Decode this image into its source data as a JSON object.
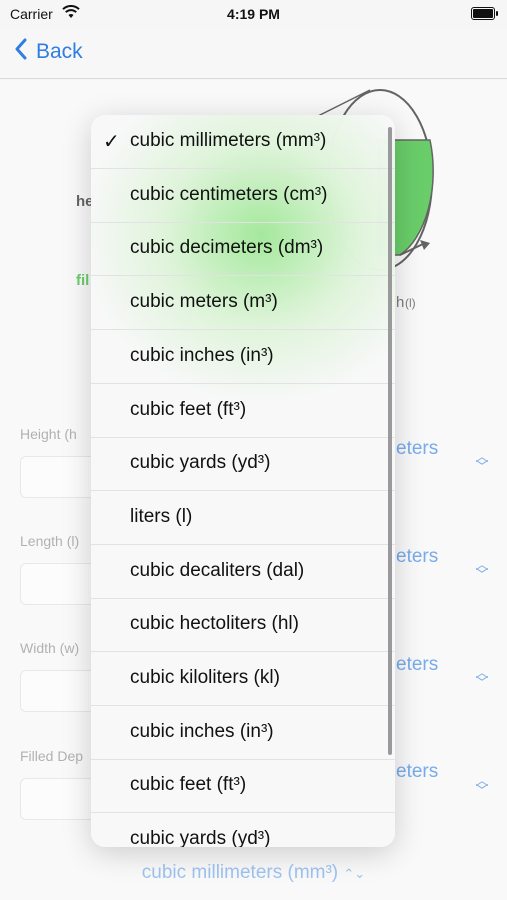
{
  "status": {
    "carrier": "Carrier",
    "time": "4:19 PM"
  },
  "nav": {
    "back_label": "Back"
  },
  "diagram": {
    "label_height_partial": "he",
    "label_filled_partial": "fil",
    "label_unit_right": "(l)",
    "label_h_tail": "h",
    "green_color": "#19b21a"
  },
  "form": {
    "fields": [
      {
        "label": "Height (h",
        "unit": "eters"
      },
      {
        "label": "Length (l)",
        "unit": "eters"
      },
      {
        "label": "Width (w)",
        "unit": "eters"
      },
      {
        "label": "Filled Dep",
        "unit": "eters"
      }
    ],
    "bottom_unit": "cubic millimeters (mm³)"
  },
  "menu": {
    "selected_index": 0,
    "check": "✓",
    "items": [
      "cubic millimeters (mm³)",
      "cubic centimeters (cm³)",
      "cubic decimeters (dm³)",
      "cubic meters (m³)",
      "cubic inches (in³)",
      "cubic feet (ft³)",
      "cubic yards (yd³)",
      "liters (l)",
      "cubic decaliters (dal)",
      "cubic hectoliters (hl)",
      "cubic kiloliters (kl)",
      "cubic inches (in³)",
      "cubic feet (ft³)",
      "cubic yards (yd³)"
    ]
  },
  "colors": {
    "accent": "#2f7ee0",
    "green": "#19b21a"
  }
}
